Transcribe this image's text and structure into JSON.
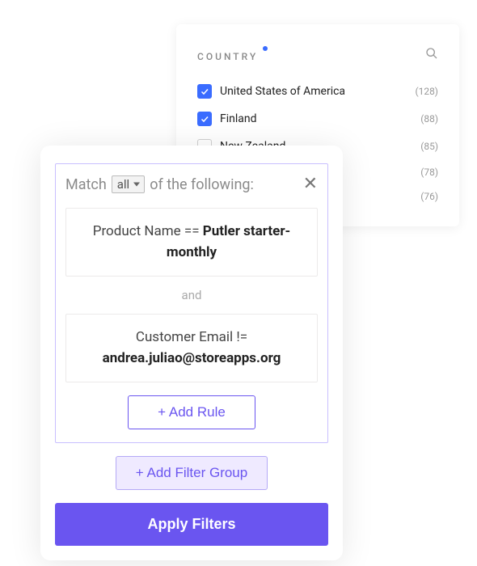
{
  "country_panel": {
    "title": "COUNTRY",
    "items": [
      {
        "label": "United States of America",
        "count": "(128)",
        "checked": true
      },
      {
        "label": "Finland",
        "count": "(88)",
        "checked": true
      },
      {
        "label": "New Zealand",
        "count": "(85)",
        "checked": false
      },
      {
        "label": "",
        "count": "(78)",
        "checked": false,
        "hidden_checkbox": true
      },
      {
        "label": "",
        "count": "(76)",
        "checked": false,
        "hidden_checkbox": true
      }
    ]
  },
  "filter_panel": {
    "match_prefix": "Match",
    "match_mode": "all",
    "match_suffix": "of the following:",
    "rules": [
      {
        "field": "Product Name",
        "op": "==",
        "value": "Putler starter-monthly"
      },
      {
        "field": "Customer Email",
        "op": "!=",
        "value": "andrea.juliao@storeapps.org"
      }
    ],
    "separator": "and",
    "add_rule_label": "+ Add Rule",
    "add_group_label": "+ Add Filter Group",
    "apply_label": "Apply Filters"
  }
}
